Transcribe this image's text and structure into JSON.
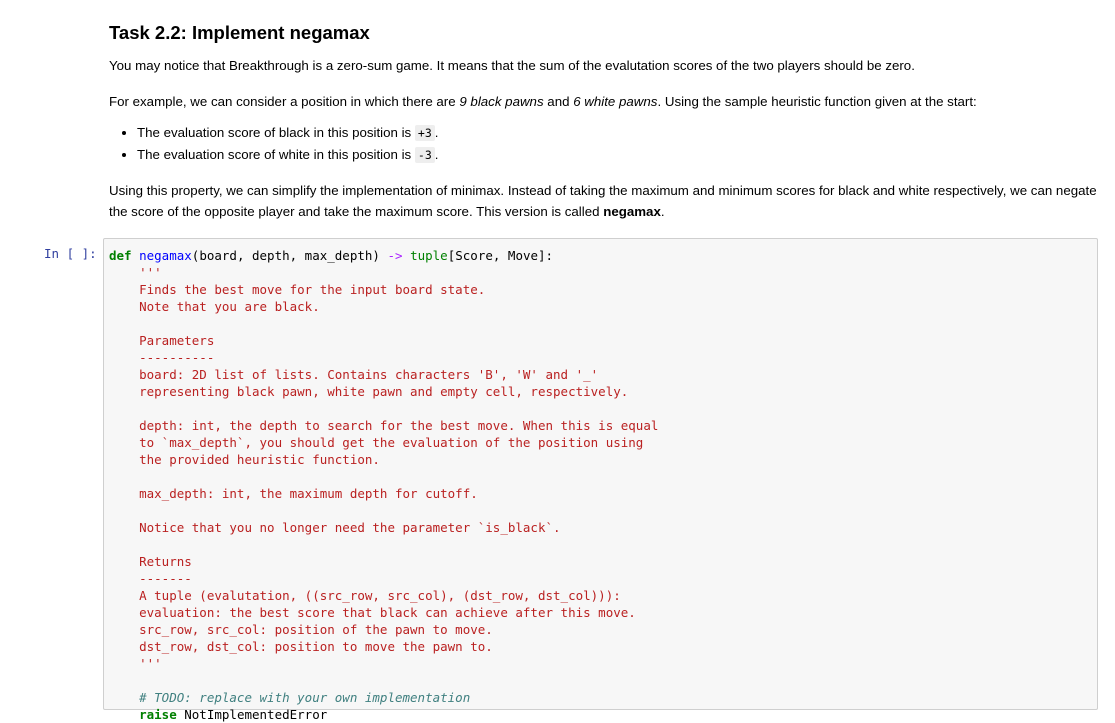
{
  "markdown": {
    "title": "Task 2.2: Implement negamax",
    "p1": "You may notice that Breakthrough is a zero-sum game. It means that the sum of the evalutation scores of the two players should be zero.",
    "p2": {
      "prefix": "For example, we can consider a position in which there are ",
      "black": "9 black pawns",
      "and": " and ",
      "white": "6 white pawns",
      "suffix": ". Using the sample heuristic function given at the start:"
    },
    "bullets": [
      {
        "text": "The evaluation score of black in this position is ",
        "code": "+3",
        "end": "."
      },
      {
        "text": "The evaluation score of white in this position is ",
        "code": "-3",
        "end": "."
      }
    ],
    "p3": {
      "text": "Using this property, we can simplify the implementation of minimax. Instead of taking the maximum and minimum scores for black and white respectively, we can negate the score of the opposite player and take the maximum score. This version is called ",
      "bold": "negamax",
      "end": "."
    }
  },
  "cell": {
    "prompt": "In [ ]:",
    "def_kw": "def",
    "fn_name": "negamax",
    "params": "(board, depth, max_depth)",
    "arrow": "->",
    "return_type": "tuple",
    "return_args": "[Score, Move]:",
    "docstring": "    '''\n    Finds the best move for the input board state.\n    Note that you are black.\n\n    Parameters\n    ----------\n    board: 2D list of lists. Contains characters 'B', 'W' and '_'\n    representing black pawn, white pawn and empty cell, respectively.\n\n    depth: int, the depth to search for the best move. When this is equal\n    to `max_depth`, you should get the evaluation of the position using\n    the provided heuristic function.\n\n    max_depth: int, the maximum depth for cutoff.\n\n    Notice that you no longer need the parameter `is_black`.\n\n    Returns\n    -------\n    A tuple (evalutation, ((src_row, src_col), (dst_row, dst_col))):\n    evaluation: the best score that black can achieve after this move.\n    src_row, src_col: position of the pawn to move.\n    dst_row, dst_col: position to move the pawn to.\n    '''",
    "comment": "    # TODO: replace with your own implementation",
    "raise_kw": "    raise",
    "raise_name": " NotImplementedError"
  }
}
